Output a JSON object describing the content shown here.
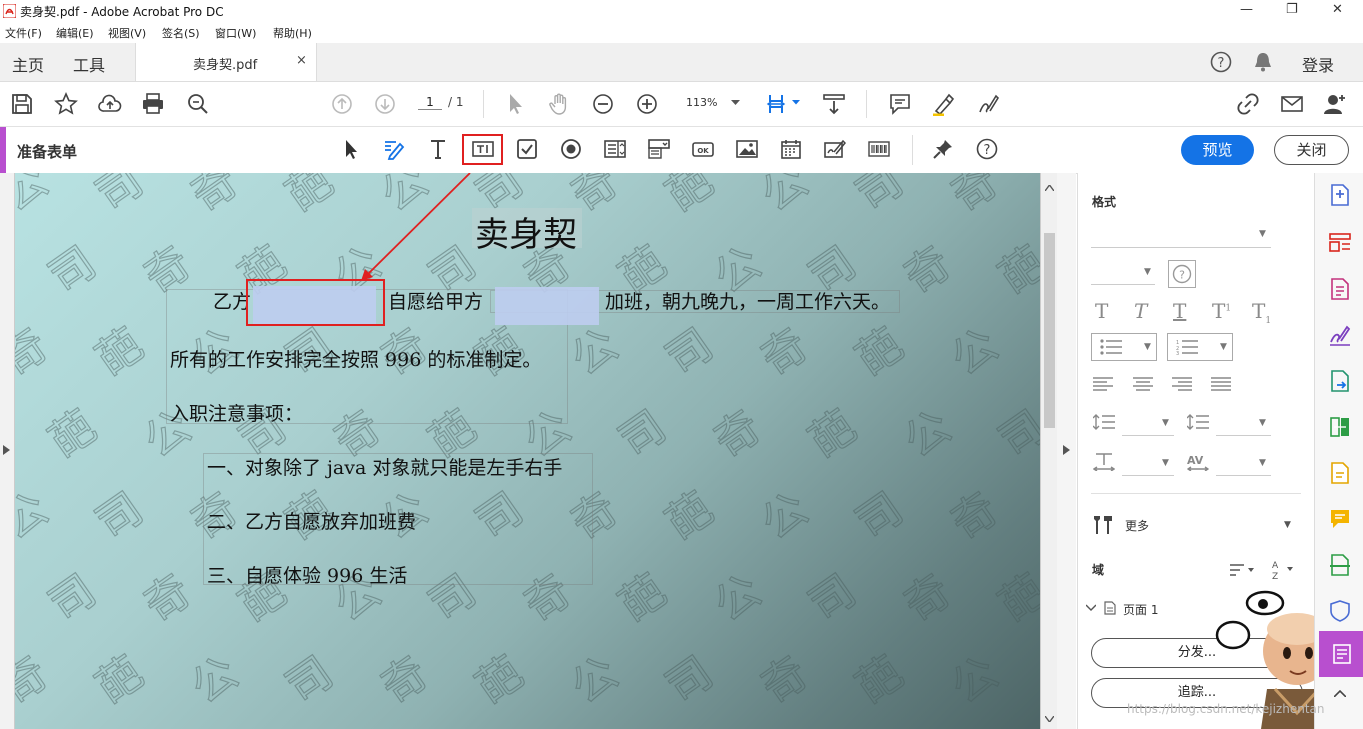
{
  "window": {
    "title": "卖身契.pdf - Adobe Acrobat Pro DC",
    "minimize": "—",
    "maximize": "❐",
    "close": "✕"
  },
  "menu": [
    "文件(F)",
    "编辑(E)",
    "视图(V)",
    "签名(S)",
    "窗口(W)",
    "帮助(H)"
  ],
  "tabs": {
    "home": "主页",
    "tools": "工具",
    "document": "卖身契.pdf",
    "close_glyph": "×",
    "login": "登录"
  },
  "toolbar": {
    "page_current": "1",
    "page_total": "/ 1",
    "zoom": "113%"
  },
  "forms_bar": {
    "title": "准备表单",
    "preview": "预览",
    "close": "关闭",
    "accent_color": "#b84fcf",
    "primary_color": "#1473e6"
  },
  "document": {
    "heading": "卖身契",
    "line1_a": "乙方",
    "line1_b": "自愿给甲方",
    "line1_c": "加班，朝九晚九，一周工作六天。",
    "line2": "所有的工作安排完全按照 996 的标准制定。",
    "line3": "入职注意事项：",
    "item1": "一、对象除了 java 对象就只能是左手右手",
    "item2": "二、乙方自愿放弃加班费",
    "item3": "三、自愿体验 996 生活",
    "watermark": "奇葩公司"
  },
  "format_panel": {
    "format_label": "格式",
    "more_label": "更多",
    "fields_label": "域",
    "page_node": "页面 1",
    "distribute": "分发...",
    "track": "追踪..."
  },
  "url_watermark": "https://blog.csdn.net/kejizhentan"
}
